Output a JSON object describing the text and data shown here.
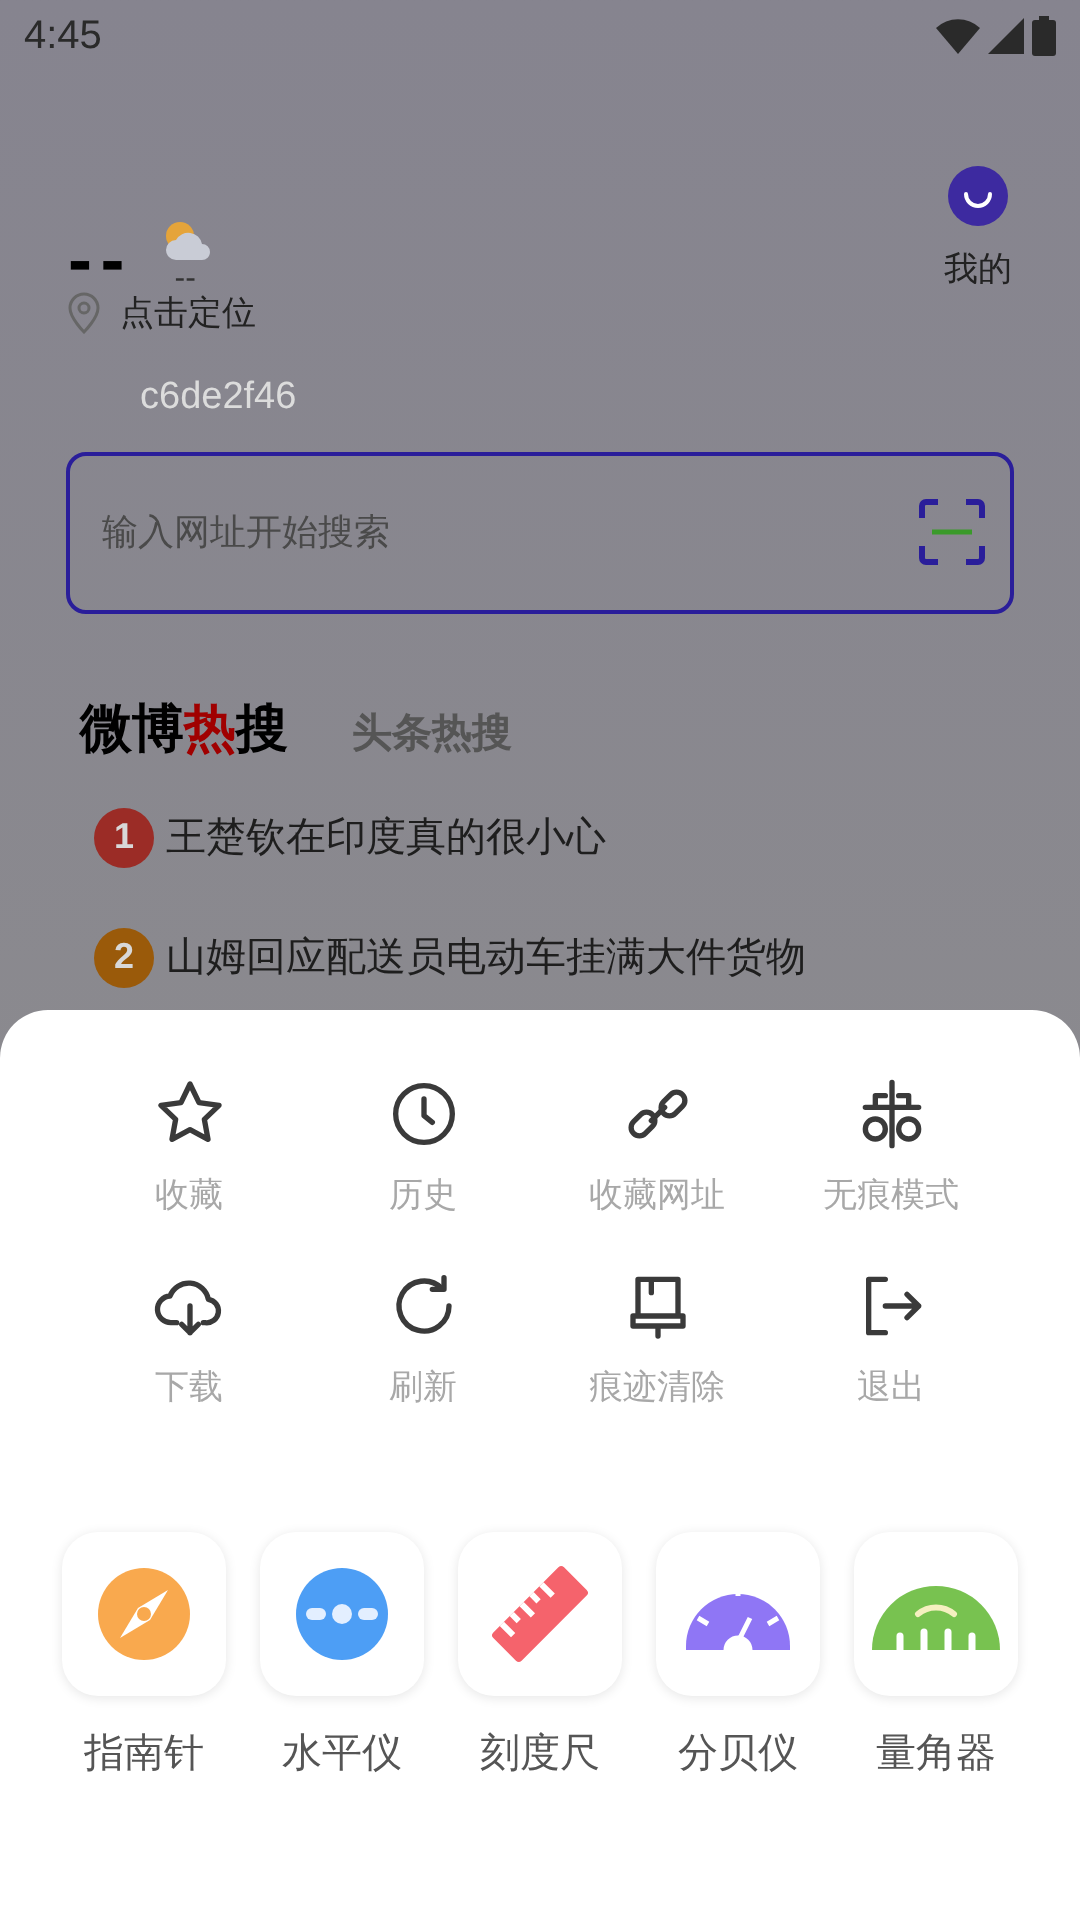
{
  "status_bar": {
    "time": "4:45"
  },
  "weather": {
    "temperature": "--",
    "condition": "--"
  },
  "profile": {
    "label": "我的"
  },
  "location": {
    "label": "点击定位"
  },
  "device_id": "c6de2f46",
  "search": {
    "placeholder": "输入网址开始搜索"
  },
  "hot_tabs": [
    {
      "parts": [
        {
          "text": "微博",
          "highlight": false
        },
        {
          "text": "热",
          "highlight": true
        },
        {
          "text": "搜",
          "highlight": false
        }
      ],
      "selected": true
    },
    {
      "parts": [
        {
          "text": "头条热搜",
          "highlight": false
        }
      ],
      "selected": false
    }
  ],
  "hot_list": [
    {
      "rank": "1",
      "title": "王楚钦在印度真的很小心",
      "color": "#9b2c26"
    },
    {
      "rank": "2",
      "title": "山姆回应配送员电动车挂满大件货物",
      "color": "#9a5a0a"
    }
  ],
  "menu": [
    {
      "kind": "star",
      "label": "收藏"
    },
    {
      "kind": "clock",
      "label": "历史"
    },
    {
      "kind": "link",
      "label": "收藏网址"
    },
    {
      "kind": "incognito",
      "label": "无痕模式"
    },
    {
      "kind": "download",
      "label": "下载"
    },
    {
      "kind": "refresh",
      "label": "刷新"
    },
    {
      "kind": "clear",
      "label": "痕迹清除"
    },
    {
      "kind": "exit",
      "label": "退出"
    }
  ],
  "tools": [
    {
      "kind": "compass",
      "label": "指南针"
    },
    {
      "kind": "level",
      "label": "水平仪"
    },
    {
      "kind": "ruler",
      "label": "刻度尺"
    },
    {
      "kind": "decibel",
      "label": "分贝仪"
    },
    {
      "kind": "protractor",
      "label": "量角器"
    }
  ]
}
